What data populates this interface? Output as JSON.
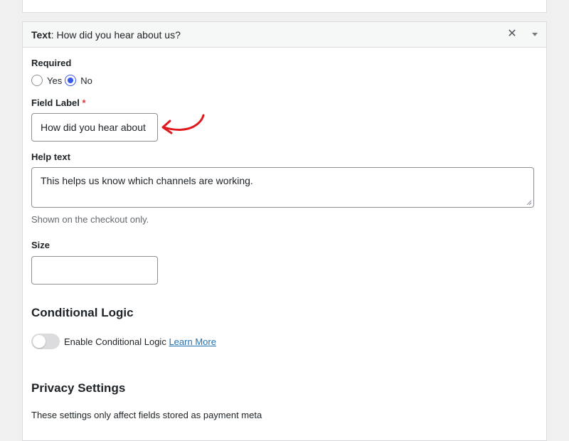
{
  "colors": {
    "accent": "#3858e9",
    "link": "#2271b1",
    "required": "#d63638",
    "annotation_arrow": "#e0191e"
  },
  "field_panel": {
    "type_label": "Text",
    "title": "How did you hear about us?",
    "close_icon": "close-icon",
    "toggle_icon": "chevron-down-icon"
  },
  "required": {
    "label": "Required",
    "options": [
      {
        "label": "Yes",
        "checked": false
      },
      {
        "label": "No",
        "checked": true
      }
    ]
  },
  "field_label": {
    "label": "Field Label",
    "required_marker": "*",
    "value": "How did you hear about"
  },
  "help_text": {
    "label": "Help text",
    "value": "This helps us know which channels are working.",
    "description": "Shown on the checkout only."
  },
  "size": {
    "label": "Size",
    "value": ""
  },
  "conditional_logic": {
    "heading": "Conditional Logic",
    "toggle_label": "Enable Conditional Logic",
    "toggle_on": false,
    "learn_more": "Learn More"
  },
  "privacy": {
    "heading": "Privacy Settings",
    "description": "These settings only affect fields stored as payment meta"
  }
}
